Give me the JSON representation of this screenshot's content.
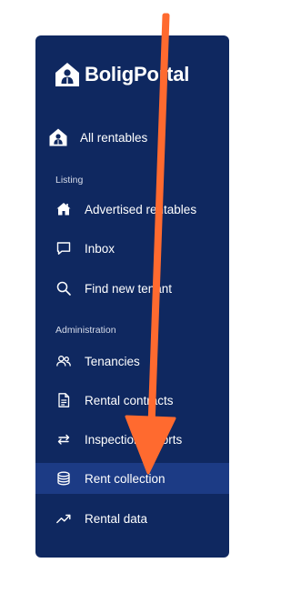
{
  "brand": {
    "name": "BoligPortal"
  },
  "all_rentables": {
    "label": "All rentables",
    "icon": "house-person-icon"
  },
  "sections": {
    "listing": "Listing",
    "administration": "Administration"
  },
  "nav": {
    "advertised": {
      "label": "Advertised rentables",
      "icon": "house-icon"
    },
    "inbox": {
      "label": "Inbox",
      "icon": "chat-icon"
    },
    "find_tenant": {
      "label": "Find new tenant",
      "icon": "search-icon"
    },
    "tenancies": {
      "label": "Tenancies",
      "icon": "people-icon"
    },
    "contracts": {
      "label": "Rental contracts",
      "icon": "document-icon"
    },
    "inspection": {
      "label": "Inspection reports",
      "icon": "swap-arrows-icon"
    },
    "rent_collection": {
      "label": "Rent collection",
      "icon": "coin-stack-icon",
      "active": true
    },
    "rental_data": {
      "label": "Rental data",
      "icon": "trend-up-icon"
    }
  },
  "colors": {
    "sidebar_bg": "#0f2860",
    "active_bg": "#1c3b85",
    "annotation_arrow": "#ff6a2f"
  }
}
